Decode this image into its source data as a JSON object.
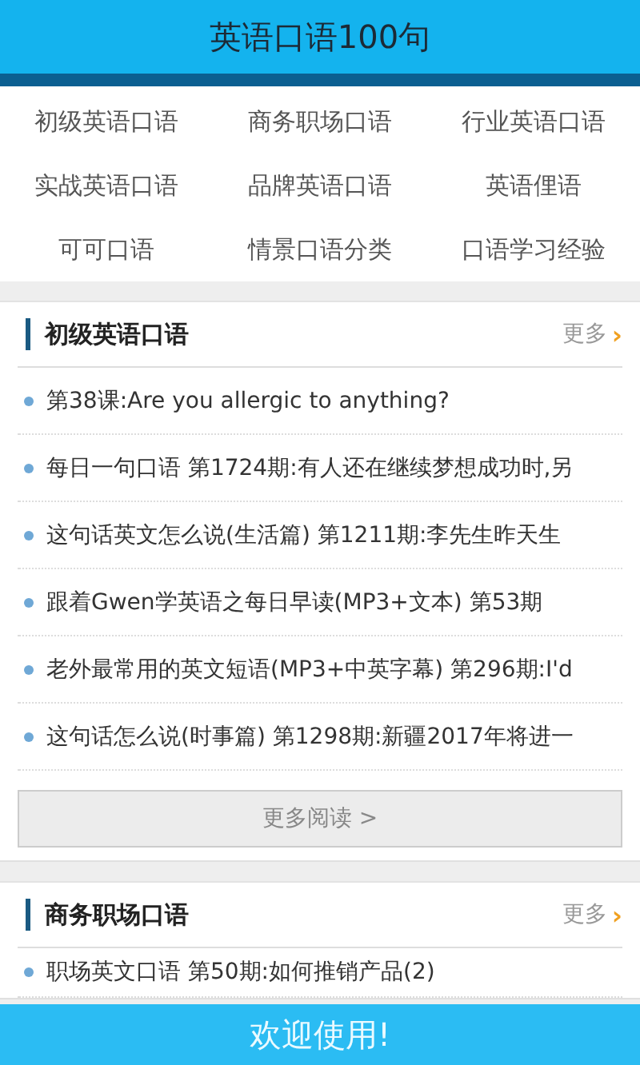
{
  "header": {
    "title": "英语口语100句"
  },
  "categories": [
    {
      "label": "初级英语口语"
    },
    {
      "label": "商务职场口语"
    },
    {
      "label": "行业英语口语"
    },
    {
      "label": "实战英语口语"
    },
    {
      "label": "品牌英语口语"
    },
    {
      "label": "英语俚语"
    },
    {
      "label": "可可口语"
    },
    {
      "label": "情景口语分类"
    },
    {
      "label": "口语学习经验"
    }
  ],
  "sections": [
    {
      "title": "初级英语口语",
      "more": "更多",
      "more_icon": "›",
      "items": [
        "第38课:Are you allergic to anything?",
        "每日一句口语 第1724期:有人还在继续梦想成功时,另",
        "这句话英文怎么说(生活篇) 第1211期:李先生昨天生",
        "跟着Gwen学英语之每日早读(MP3+文本) 第53期",
        "老外最常用的英文短语(MP3+中英字幕) 第296期:I'd",
        "这句话怎么说(时事篇) 第1298期:新疆2017年将进一"
      ],
      "read_more": "更多阅读 >"
    },
    {
      "title": "商务职场口语",
      "more": "更多",
      "more_icon": "›",
      "items": [
        "职场英文口语 第50期:如何推销产品(2)"
      ]
    }
  ],
  "footer": {
    "text": "欢迎使用!"
  }
}
